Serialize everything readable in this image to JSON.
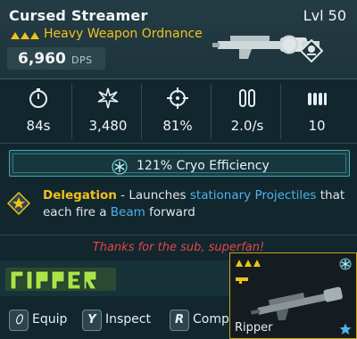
{
  "item": {
    "name": "Cursed Streamer",
    "level": "Lvl 50",
    "subtype": "Heavy Weapon Ordnance",
    "dps_value": "6,960",
    "dps_unit": "DPS",
    "manufacturer_badge": "Ripper"
  },
  "stats": [
    {
      "icon": "stopwatch-icon",
      "value": "84s"
    },
    {
      "icon": "impact-burst-icon",
      "value": "3,480"
    },
    {
      "icon": "crosshair-icon",
      "value": "81%"
    },
    {
      "icon": "fire-rate-icon",
      "value": "2.0/s"
    },
    {
      "icon": "ammo-icon",
      "value": "10"
    }
  ],
  "element": {
    "icon": "snowflake-icon",
    "label": "121% Cryo Efficiency"
  },
  "perk": {
    "name": "Delegation",
    "dash": " - Launches ",
    "kw1": "stationary Projectiles",
    "mid": " that each fire a ",
    "kw2": "Beam",
    "end": " forward"
  },
  "flavor": "Thanks for the sub, superfan!",
  "prompts": [
    {
      "key": "⬯",
      "label": "Equip"
    },
    {
      "key": "Y",
      "label": "Inspect"
    },
    {
      "key": "R",
      "label": "Compa"
    }
  ],
  "skin_card": {
    "name": "Ripper"
  },
  "colors": {
    "legendary": "#f1c21b",
    "cryo": "#3ea9b3",
    "keyword": "#4fb3e6",
    "flavor": "#e04848"
  }
}
